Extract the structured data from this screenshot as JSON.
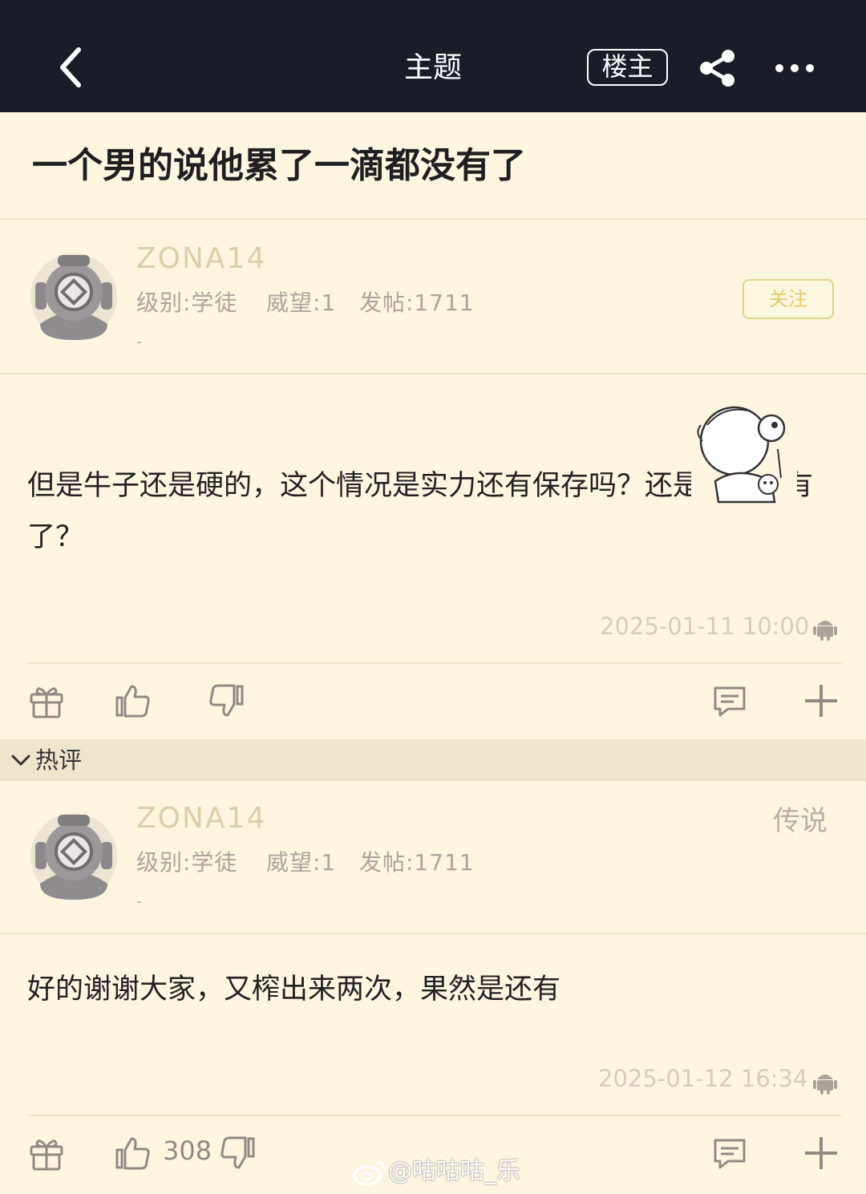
{
  "nav": {
    "title": "主题",
    "op_label": "楼主"
  },
  "thread": {
    "title": "一个男的说他累了一滴都没有了"
  },
  "post": {
    "username": "ZONA14",
    "level": "级别:学徒",
    "prestige": "威望:1",
    "posts": "发帖:1711",
    "dash": "-",
    "follow_label": "关注",
    "body": "但是牛子还是硬的，这个情况是实力还有保存吗？还是真的没有了？",
    "timestamp": "2025-01-11 10:00"
  },
  "hot_section": {
    "label": "热评"
  },
  "reply": {
    "username": "ZONA14",
    "level": "级别:学徒",
    "prestige": "威望:1",
    "posts": "发帖:1711",
    "dash": "-",
    "tag": "传说",
    "body": "好的谢谢大家，又榨出来两次，果然是还有",
    "timestamp": "2025-01-12 16:34",
    "like_count": "308"
  },
  "watermark": "@咕咕咕_乐",
  "icons": [
    "back-icon",
    "share-icon",
    "more-icon",
    "avatar-icon",
    "sticker-icon",
    "android-icon",
    "gift-icon",
    "thumb-up-icon",
    "thumb-down-icon",
    "comment-icon",
    "plus-icon",
    "chevron-down-icon",
    "weibo-icon"
  ],
  "colors": {
    "topbar": "#1b1c26",
    "background": "#fcf6e1",
    "username": "#d9cfaa",
    "follow_accent": "#e3c96b"
  }
}
